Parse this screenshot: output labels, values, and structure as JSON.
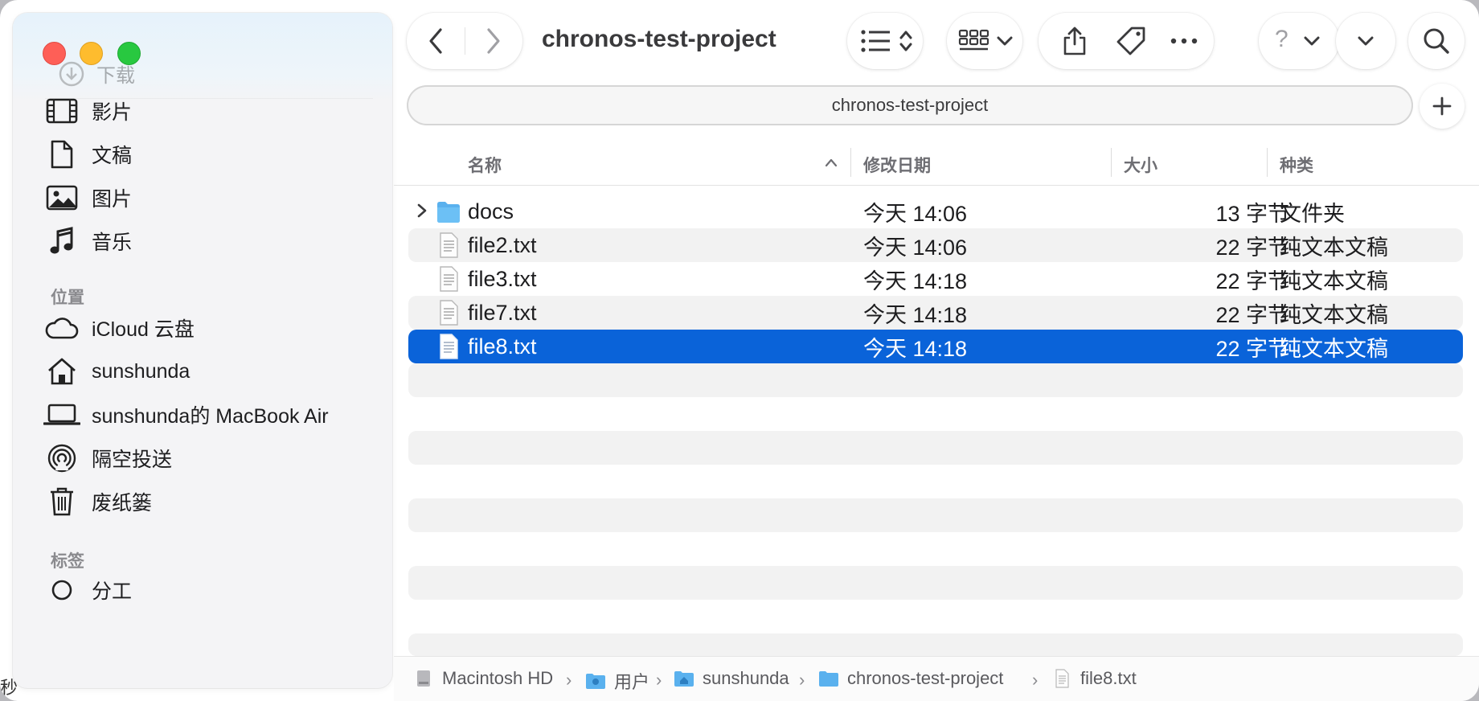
{
  "window": {
    "title": "chronos-test-project"
  },
  "sidebar": {
    "faded_item": "下载",
    "favorites": [
      {
        "label": "影片",
        "icon": "film-icon"
      },
      {
        "label": "文稿",
        "icon": "document-icon"
      },
      {
        "label": "图片",
        "icon": "photo-icon"
      },
      {
        "label": "音乐",
        "icon": "music-note-icon"
      }
    ],
    "locations_header": "位置",
    "locations": [
      {
        "label": "iCloud 云盘",
        "icon": "cloud-icon"
      },
      {
        "label": "sunshunda",
        "icon": "home-icon"
      },
      {
        "label": "sunshunda的 MacBook Air",
        "icon": "laptop-icon"
      },
      {
        "label": "隔空投送",
        "icon": "airdrop-icon"
      },
      {
        "label": "废纸篓",
        "icon": "trash-icon"
      }
    ],
    "tags_header": "标签",
    "tags": [
      {
        "label": "分工",
        "icon": "tag-circle-icon"
      }
    ]
  },
  "toolbar": {
    "back_icon": "chevron-left-icon",
    "forward_icon": "chevron-right-icon",
    "help_glyph": "?"
  },
  "pathbar": {
    "text": "chronos-test-project"
  },
  "columns": {
    "name": "名称",
    "date": "修改日期",
    "size": "大小",
    "kind": "种类"
  },
  "files": [
    {
      "name": "docs",
      "date": "今天 14:06",
      "size": "13 字节",
      "kind": "文件夹",
      "type": "folder"
    },
    {
      "name": "file2.txt",
      "date": "今天 14:06",
      "size": "22 字节",
      "kind": "纯文本文稿",
      "type": "text"
    },
    {
      "name": "file3.txt",
      "date": "今天 14:18",
      "size": "22 字节",
      "kind": "纯文本文稿",
      "type": "text"
    },
    {
      "name": "file7.txt",
      "date": "今天 14:18",
      "size": "22 字节",
      "kind": "纯文本文稿",
      "type": "text"
    },
    {
      "name": "file8.txt",
      "date": "今天 14:18",
      "size": "22 字节",
      "kind": "纯文本文稿",
      "type": "text",
      "selected": true
    }
  ],
  "status_path": [
    "Macintosh HD",
    "用户",
    "sunshunda",
    "chronos-test-project",
    "file8.txt"
  ],
  "edge_glyph": "秒",
  "colors": {
    "selection": "#0a63d9",
    "folder": "#5ab1ee",
    "close": "#fe5f57",
    "minimize": "#febc2e",
    "zoom": "#28c840"
  }
}
